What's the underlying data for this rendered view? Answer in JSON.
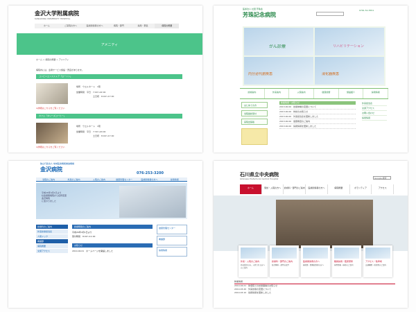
{
  "p1": {
    "title": "金沢大学附属病院",
    "subtitle": "KANAZAWA UNIVERSITY HOSPITAL",
    "nav": [
      "ホーム",
      "ご来院の方へ",
      "医療関係者の方へ",
      "病院・部門",
      "採用・募集",
      "病院の概要"
    ],
    "hero": "アメニティ",
    "breadcrumb": "ホーム > 病院の概要 > アメニティ",
    "intro": "病院内には、患者サービス施設・売店があります。",
    "sections": [
      {
        "label": "コンビニエンスストア「ローソン」",
        "loc": "場所　ウエルネート　1階",
        "hours1": "営業時間　平日　7:00～22:00",
        "hours2": "土日祝　8:00～17:00",
        "note": "※詳細はこちらをご覧ください"
      },
      {
        "label": "カフェ「タリーズコーヒー」",
        "loc": "場所　ウエルネート　1階",
        "hours1": "営業時間　平日　7:30～20:00",
        "hours2": "土日祝　8:00～17:00",
        "note": "※詳細はこちらをご覧ください"
      }
    ]
  },
  "p2": {
    "pre": "医療法人 社団 芳珠会",
    "title": "芳珠記念病院",
    "tel": "0761-51-5551",
    "banners": [
      "がん診療",
      "リハビリテーション",
      "内分泌代謝疾患",
      "消化器疾患"
    ],
    "menu": [
      "診療案内",
      "外来案内",
      "入院案内",
      "健康診断",
      "施設紹介",
      "採用情報"
    ],
    "side": [
      "はじめての方",
      "当院健診受付",
      "来院出張版"
    ],
    "news_header": "新着情報・お知らせ",
    "news": [
      "2013.00.00　診療体制の変更について",
      "2013.00.00　休診のお知らせ",
      "2013.00.00　外来担当表を更新しました",
      "2013.00.00　健康教室のご案内",
      "2013.00.00　採用情報を更新しました"
    ],
    "links": [
      "外来担当表",
      "交通アクセス",
      "お問い合わせ",
      "採用情報"
    ]
  },
  "p3": {
    "pre": "独立行政法人 地域医療機能推進機構",
    "title": "金沢病院",
    "tel": "076-253-3200",
    "nav": [
      "当院のご案内",
      "外来のご案内",
      "入院のご案内",
      "健康管理センター",
      "医療関係者の方へ",
      "採用情報"
    ],
    "hero_text": "平成26年4月1日より\n社会保険病院から名称変更\n金沢病院\nに変わりました",
    "left": [
      "診療科のご案内",
      "外来診療担当表",
      "人間ドック",
      "看護部",
      "病院概要",
      "交通アクセス"
    ],
    "mid_header": "診療時間のご案内",
    "mid_rows": [
      "平成26年4月1日より",
      "受付時間　8:00～11:00",
      "お知らせ",
      "2014.04.01　ホームページを開設しました"
    ],
    "right": [
      "健康管理センター",
      "看護部",
      "採用情報"
    ]
  },
  "p4": {
    "title": "石川県立中央病院",
    "subtitle": "Ishikawa Prefectural Central Hospital",
    "search": "Google 検索",
    "nav": [
      "ホーム",
      "受診・入院の方へ",
      "診療科・部門のご案内",
      "医療関係者の方へ",
      "病院概要",
      "ボランティア",
      "アクセス"
    ],
    "cards": [
      {
        "title": "外来・入院のご案内",
        "desc": "外来受診の方、入院される方へのご案内"
      },
      {
        "title": "診療科・部門のご案内",
        "desc": "各診療科・部門の紹介"
      },
      {
        "title": "医療関係者の方へ",
        "desc": "研修医・医療従事者の方へ"
      },
      {
        "title": "職員採用・臨床研修",
        "desc": "採用情報・研修のご案内"
      },
      {
        "title": "アクセス・駐車場",
        "desc": "交通機関・駐車場のご案内"
      }
    ],
    "news_header": "新着情報",
    "news": [
      "2014.04.01　新病院での診療開始のお知らせ",
      "2014.03.20　外来診療の変更について",
      "2014.03.10　採用情報を更新しました"
    ]
  }
}
